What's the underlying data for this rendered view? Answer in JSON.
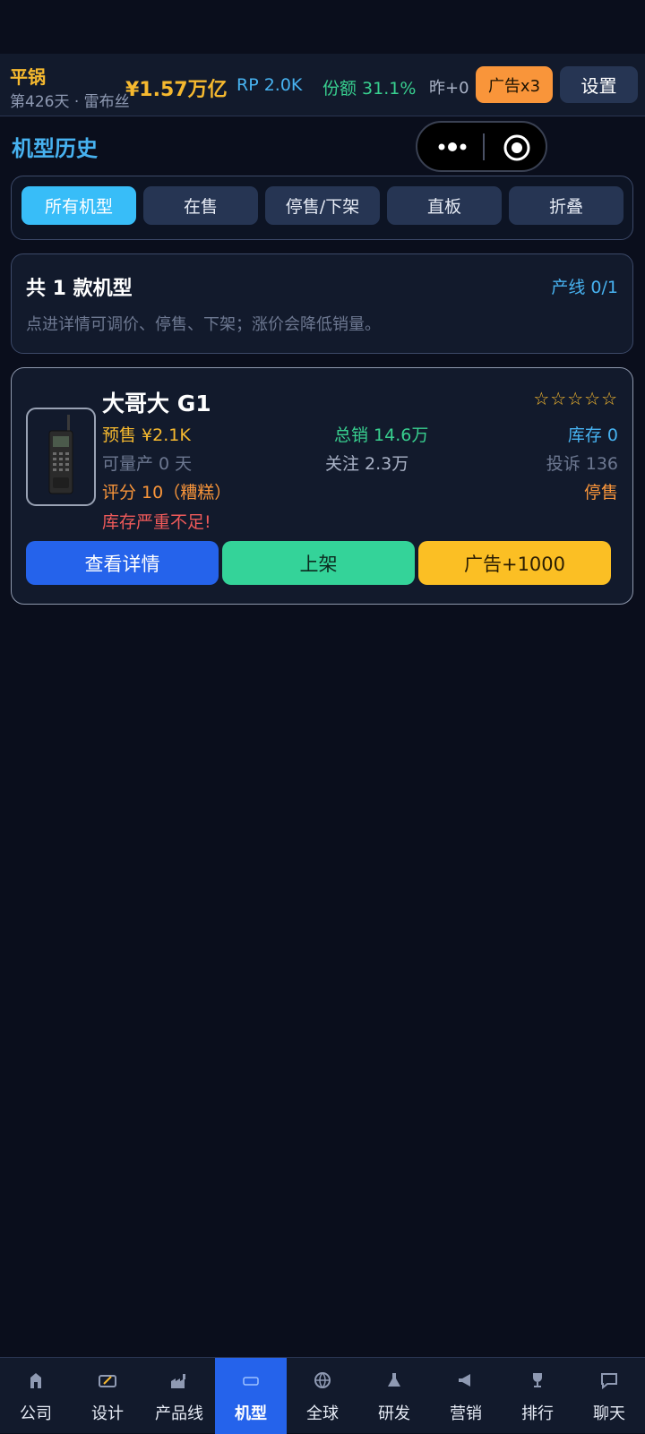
{
  "header": {
    "company": "平锅",
    "day_info": "第426天 · 雷布丝",
    "money": "¥1.57万亿",
    "rp": "RP 2.0K",
    "share": "份额 31.1%",
    "yesterday": "昨+0",
    "ad_button": "广告x3",
    "settings_button": "设置"
  },
  "page": {
    "title": "机型历史"
  },
  "filters": [
    {
      "label": "所有机型",
      "active": true
    },
    {
      "label": "在售",
      "active": false
    },
    {
      "label": "停售/下架",
      "active": false
    },
    {
      "label": "直板",
      "active": false
    },
    {
      "label": "折叠",
      "active": false
    }
  ],
  "summary": {
    "title": "共 1 款机型",
    "line": "产线 0/1",
    "hint": "点进详情可调价、停售、下架；涨价会降低销量。"
  },
  "phone": {
    "name": "大哥大 G1",
    "stars": "☆☆☆☆☆",
    "presale": "预售 ¥2.1K",
    "total_sales": "总销 14.6万",
    "stock": "库存 0",
    "capacity": "可量产 0 天",
    "follow": "关注 2.3万",
    "complaints": "投诉 136",
    "rating": "评分 10（糟糕）",
    "status": "停售",
    "warning": "库存严重不足!",
    "buttons": {
      "detail": "查看详情",
      "list": "上架",
      "ad": "广告+1000"
    }
  },
  "nav": [
    {
      "label": "公司",
      "icon": "building-icon"
    },
    {
      "label": "设计",
      "icon": "design-icon"
    },
    {
      "label": "产品线",
      "icon": "factory-icon"
    },
    {
      "label": "机型",
      "icon": "phone-icon",
      "active": true
    },
    {
      "label": "全球",
      "icon": "globe-icon"
    },
    {
      "label": "研发",
      "icon": "flask-icon"
    },
    {
      "label": "营销",
      "icon": "megaphone-icon"
    },
    {
      "label": "排行",
      "icon": "trophy-icon"
    },
    {
      "label": "聊天",
      "icon": "chat-icon"
    }
  ],
  "colors": {
    "background": "#0a0e1c",
    "accent_blue": "#47b2f0",
    "gold": "#f6b92f",
    "green": "#38cf8f",
    "orange": "#f9953a",
    "red": "#ef5a5a"
  }
}
